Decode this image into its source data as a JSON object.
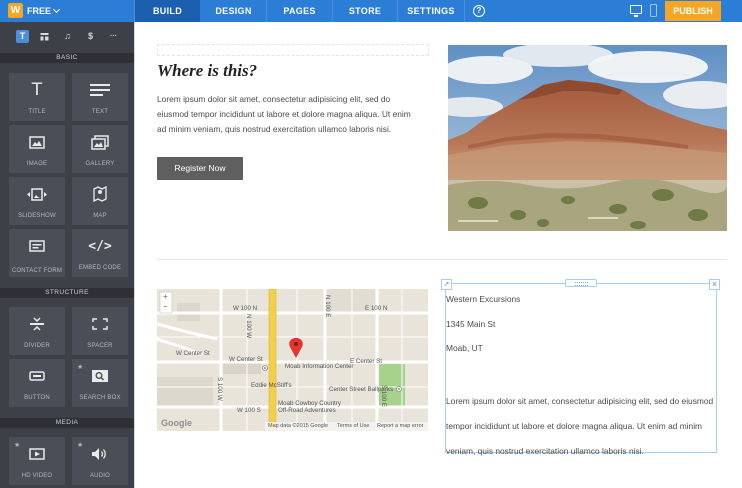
{
  "topbar": {
    "logo": "W",
    "plan": "FREE",
    "tabs": [
      "BUILD",
      "DESIGN",
      "PAGES",
      "STORE",
      "SETTINGS"
    ],
    "active_tab": "BUILD",
    "help": "?",
    "publish": "PUBLISH",
    "colors": {
      "bar": "#2b7dd6",
      "active": "#1c5fae",
      "publish": "#f5a623"
    }
  },
  "sidebar": {
    "categories": [
      {
        "glyph": "T",
        "icon": "text-category-icon"
      },
      {
        "glyph": "",
        "icon": "layout-category-icon"
      },
      {
        "glyph": "♫",
        "icon": "music-category-icon"
      },
      {
        "glyph": "$",
        "icon": "store-category-icon"
      },
      {
        "glyph": "···",
        "icon": "more-category-icon"
      }
    ],
    "sections": [
      {
        "title": "BASIC",
        "items": [
          {
            "label": "TITLE",
            "icon": "title-icon"
          },
          {
            "label": "TEXT",
            "icon": "text-icon"
          },
          {
            "label": "IMAGE",
            "icon": "image-icon"
          },
          {
            "label": "GALLERY",
            "icon": "gallery-icon"
          },
          {
            "label": "SLIDESHOW",
            "icon": "slideshow-icon"
          },
          {
            "label": "MAP",
            "icon": "map-pin-icon"
          },
          {
            "label": "CONTACT FORM",
            "icon": "contact-form-icon"
          },
          {
            "label": "EMBED CODE",
            "icon": "embed-code-icon"
          }
        ]
      },
      {
        "title": "STRUCTURE",
        "items": [
          {
            "label": "DIVIDER",
            "icon": "divider-icon"
          },
          {
            "label": "SPACER",
            "icon": "spacer-icon"
          },
          {
            "label": "BUTTON",
            "icon": "button-icon"
          },
          {
            "label": "SEARCH BOX",
            "icon": "search-box-icon",
            "star": true
          }
        ]
      },
      {
        "title": "MEDIA",
        "items": [
          {
            "label": "HD VIDEO",
            "icon": "hd-video-icon",
            "star": true
          },
          {
            "label": "AUDIO",
            "icon": "audio-icon",
            "star": true
          }
        ]
      }
    ]
  },
  "content": {
    "heading": "Where is this?",
    "paragraph": "Lorem ipsum dolor sit amet, consectetur adipisicing elit, sed do eiusmod tempor incididunt ut labore et dolore magna aliqua. Ut enim ad minim veniam, quis nostrud exercitation ullamco laboris nisi.",
    "button": "Register Now",
    "address": [
      "Western Excursions",
      "1345 Main St",
      "Moab, UT"
    ],
    "paragraph2": "Lorem ipsum dolor sit amet, consectetur adipisicing elit, sed do eiusmod tempor incididunt ut labore et dolore magna aliqua. Ut enim ad minim veniam, quis nostrud exercitation ullamco laboris nisi."
  },
  "map": {
    "streets": [
      "W 100 N",
      "E 100 N",
      "W Center St",
      "W Center St",
      "E Center St",
      "N 100 W",
      "N 100 E",
      "S 100 W",
      "S 100 E",
      "W 100 S"
    ],
    "places": [
      "Moab Information Center",
      "Eddie McStiff's",
      "Center Street Ballparks",
      "Moab Cowboy Country",
      "Off-Road Adventures"
    ],
    "logo": "Google",
    "footer": [
      "Map data ©2015 Google",
      "Terms of Use",
      "Report a map error"
    ],
    "zoom": [
      "+",
      "−"
    ]
  }
}
